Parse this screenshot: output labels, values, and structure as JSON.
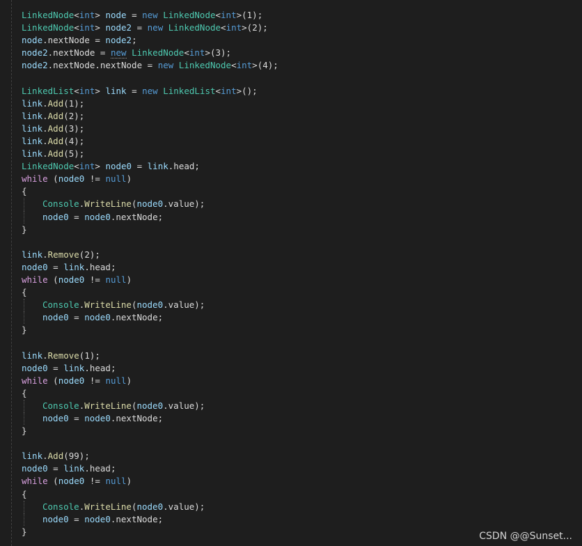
{
  "colors": {
    "background": "#1e1e1e",
    "type": "#4ec9b0",
    "keyword": "#569cd6",
    "control_keyword": "#d8a0df",
    "method": "#dcdcaa",
    "number": "#b5cea8",
    "identifier": "#9cdcfe",
    "plain": "#dcdcdc"
  },
  "code_lines": [
    [
      [
        "LinkedNode",
        "type"
      ],
      [
        "<",
        "plain"
      ],
      [
        "int",
        "keyword"
      ],
      [
        "> ",
        "plain"
      ],
      [
        "node",
        "identifier"
      ],
      [
        " = ",
        "plain"
      ],
      [
        "new",
        "keyword"
      ],
      [
        " ",
        "plain"
      ],
      [
        "LinkedNode",
        "type"
      ],
      [
        "<",
        "plain"
      ],
      [
        "int",
        "keyword"
      ],
      [
        ">(1);",
        "plain"
      ]
    ],
    [
      [
        "LinkedNode",
        "type"
      ],
      [
        "<",
        "plain"
      ],
      [
        "int",
        "keyword"
      ],
      [
        "> ",
        "plain"
      ],
      [
        "node2",
        "identifier"
      ],
      [
        " = ",
        "plain"
      ],
      [
        "new",
        "keyword"
      ],
      [
        " ",
        "plain"
      ],
      [
        "LinkedNode",
        "type"
      ],
      [
        "<",
        "plain"
      ],
      [
        "int",
        "keyword"
      ],
      [
        ">(2);",
        "plain"
      ]
    ],
    [
      [
        "node",
        "identifier"
      ],
      [
        ".nextNode = ",
        "plain"
      ],
      [
        "node2",
        "identifier"
      ],
      [
        ";",
        "plain"
      ]
    ],
    [
      [
        "node2",
        "identifier"
      ],
      [
        ".nextNode = ",
        "plain"
      ],
      [
        "new",
        "keyword",
        "squig"
      ],
      [
        " ",
        "plain"
      ],
      [
        "LinkedNode",
        "type"
      ],
      [
        "<",
        "plain"
      ],
      [
        "int",
        "keyword"
      ],
      [
        ">(3);",
        "plain"
      ]
    ],
    [
      [
        "node2",
        "identifier"
      ],
      [
        ".nextNode.nextNode = ",
        "plain"
      ],
      [
        "new",
        "keyword"
      ],
      [
        " ",
        "plain"
      ],
      [
        "LinkedNode",
        "type"
      ],
      [
        "<",
        "plain"
      ],
      [
        "int",
        "keyword"
      ],
      [
        ">(4);",
        "plain"
      ]
    ],
    [],
    [
      [
        "LinkedList",
        "type"
      ],
      [
        "<",
        "plain"
      ],
      [
        "int",
        "keyword"
      ],
      [
        "> ",
        "plain"
      ],
      [
        "link",
        "identifier"
      ],
      [
        " = ",
        "plain"
      ],
      [
        "new",
        "keyword"
      ],
      [
        " ",
        "plain"
      ],
      [
        "LinkedList",
        "type"
      ],
      [
        "<",
        "plain"
      ],
      [
        "int",
        "keyword"
      ],
      [
        ">();",
        "plain"
      ]
    ],
    [
      [
        "link",
        "identifier"
      ],
      [
        ".",
        "plain"
      ],
      [
        "Add",
        "method"
      ],
      [
        "(1);",
        "plain"
      ]
    ],
    [
      [
        "link",
        "identifier"
      ],
      [
        ".",
        "plain"
      ],
      [
        "Add",
        "method"
      ],
      [
        "(2);",
        "plain"
      ]
    ],
    [
      [
        "link",
        "identifier"
      ],
      [
        ".",
        "plain"
      ],
      [
        "Add",
        "method"
      ],
      [
        "(3);",
        "plain"
      ]
    ],
    [
      [
        "link",
        "identifier"
      ],
      [
        ".",
        "plain"
      ],
      [
        "Add",
        "method"
      ],
      [
        "(4);",
        "plain"
      ]
    ],
    [
      [
        "link",
        "identifier"
      ],
      [
        ".",
        "plain"
      ],
      [
        "Add",
        "method"
      ],
      [
        "(5);",
        "plain"
      ]
    ],
    [
      [
        "LinkedNode",
        "type"
      ],
      [
        "<",
        "plain"
      ],
      [
        "int",
        "keyword"
      ],
      [
        "> ",
        "plain"
      ],
      [
        "node0",
        "identifier"
      ],
      [
        " = ",
        "plain"
      ],
      [
        "link",
        "identifier"
      ],
      [
        ".head;",
        "plain"
      ]
    ],
    [
      [
        "while",
        "control_keyword"
      ],
      [
        " (",
        "plain"
      ],
      [
        "node0",
        "identifier"
      ],
      [
        " != ",
        "plain"
      ],
      [
        "null",
        "keyword"
      ],
      [
        ")",
        "plain"
      ]
    ],
    [
      [
        "{",
        "plain"
      ]
    ],
    {
      "indent": true,
      "tokens": [
        [
          "Console",
          "type"
        ],
        [
          ".",
          "plain"
        ],
        [
          "WriteLine",
          "method"
        ],
        [
          "(",
          "plain"
        ],
        [
          "node0",
          "identifier"
        ],
        [
          ".value);",
          "plain"
        ]
      ]
    },
    {
      "indent": true,
      "tokens": [
        [
          "node0",
          "identifier"
        ],
        [
          " = ",
          "plain"
        ],
        [
          "node0",
          "identifier"
        ],
        [
          ".nextNode;",
          "plain"
        ]
      ]
    },
    [
      [
        "}",
        "plain"
      ]
    ],
    [],
    [
      [
        "link",
        "identifier"
      ],
      [
        ".",
        "plain"
      ],
      [
        "Remove",
        "method"
      ],
      [
        "(2);",
        "plain"
      ]
    ],
    [
      [
        "node0",
        "identifier"
      ],
      [
        " = ",
        "plain"
      ],
      [
        "link",
        "identifier"
      ],
      [
        ".head;",
        "plain"
      ]
    ],
    [
      [
        "while",
        "control_keyword"
      ],
      [
        " (",
        "plain"
      ],
      [
        "node0",
        "identifier"
      ],
      [
        " != ",
        "plain"
      ],
      [
        "null",
        "keyword"
      ],
      [
        ")",
        "plain"
      ]
    ],
    [
      [
        "{",
        "plain"
      ]
    ],
    {
      "indent": true,
      "tokens": [
        [
          "Console",
          "type"
        ],
        [
          ".",
          "plain"
        ],
        [
          "WriteLine",
          "method"
        ],
        [
          "(",
          "plain"
        ],
        [
          "node0",
          "identifier"
        ],
        [
          ".value);",
          "plain"
        ]
      ]
    },
    {
      "indent": true,
      "tokens": [
        [
          "node0",
          "identifier"
        ],
        [
          " = ",
          "plain"
        ],
        [
          "node0",
          "identifier"
        ],
        [
          ".nextNode;",
          "plain"
        ]
      ]
    },
    [
      [
        "}",
        "plain"
      ]
    ],
    [],
    [
      [
        "link",
        "identifier"
      ],
      [
        ".",
        "plain"
      ],
      [
        "Remove",
        "method"
      ],
      [
        "(1);",
        "plain"
      ]
    ],
    [
      [
        "node0",
        "identifier"
      ],
      [
        " = ",
        "plain"
      ],
      [
        "link",
        "identifier"
      ],
      [
        ".head;",
        "plain"
      ]
    ],
    [
      [
        "while",
        "control_keyword"
      ],
      [
        " (",
        "plain"
      ],
      [
        "node0",
        "identifier"
      ],
      [
        " != ",
        "plain"
      ],
      [
        "null",
        "keyword"
      ],
      [
        ")",
        "plain"
      ]
    ],
    [
      [
        "{",
        "plain"
      ]
    ],
    {
      "indent": true,
      "tokens": [
        [
          "Console",
          "type"
        ],
        [
          ".",
          "plain"
        ],
        [
          "WriteLine",
          "method"
        ],
        [
          "(",
          "plain"
        ],
        [
          "node0",
          "identifier"
        ],
        [
          ".value);",
          "plain"
        ]
      ]
    },
    {
      "indent": true,
      "tokens": [
        [
          "node0",
          "identifier"
        ],
        [
          " = ",
          "plain"
        ],
        [
          "node0",
          "identifier"
        ],
        [
          ".nextNode;",
          "plain"
        ]
      ]
    },
    [
      [
        "}",
        "plain"
      ]
    ],
    [],
    [
      [
        "link",
        "identifier"
      ],
      [
        ".",
        "plain"
      ],
      [
        "Add",
        "method"
      ],
      [
        "(99);",
        "plain"
      ]
    ],
    [
      [
        "node0",
        "identifier"
      ],
      [
        " = ",
        "plain"
      ],
      [
        "link",
        "identifier"
      ],
      [
        ".head;",
        "plain"
      ]
    ],
    [
      [
        "while",
        "control_keyword"
      ],
      [
        " (",
        "plain"
      ],
      [
        "node0",
        "identifier"
      ],
      [
        " != ",
        "plain"
      ],
      [
        "null",
        "keyword"
      ],
      [
        ")",
        "plain"
      ]
    ],
    [
      [
        "{",
        "plain"
      ]
    ],
    {
      "indent": true,
      "tokens": [
        [
          "Console",
          "type"
        ],
        [
          ".",
          "plain"
        ],
        [
          "WriteLine",
          "method"
        ],
        [
          "(",
          "plain"
        ],
        [
          "node0",
          "identifier"
        ],
        [
          ".value);",
          "plain"
        ]
      ]
    },
    {
      "indent": true,
      "tokens": [
        [
          "node0",
          "identifier"
        ],
        [
          " = ",
          "plain"
        ],
        [
          "node0",
          "identifier"
        ],
        [
          ".nextNode;",
          "plain"
        ]
      ]
    },
    [
      [
        "}",
        "plain"
      ]
    ]
  ],
  "watermark": "CSDN @@Sunset..."
}
